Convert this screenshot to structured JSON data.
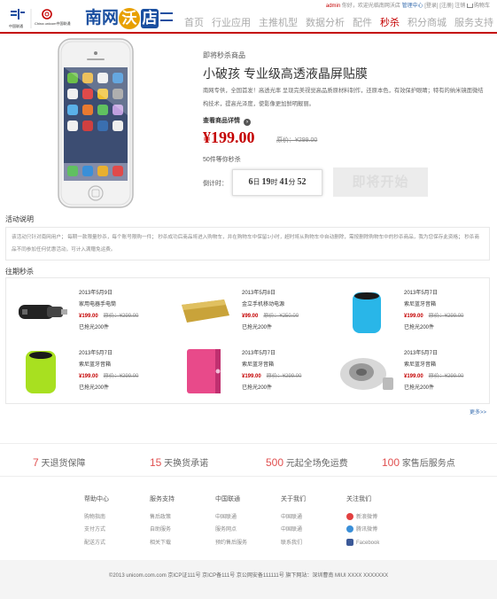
{
  "header": {
    "unicom_logo_text_cn": "中国联通",
    "unicom_logo_text_en": "China unicom中国联通",
    "brand_a": "南网",
    "brand_b": "沃",
    "brand_c": "店",
    "user": "admin",
    "greeting": "你好，欢迎光临南网沃店",
    "manage": "管理中心",
    "login": "[登录]",
    "register": "[注册]",
    "logout": "注销",
    "cart": "购物车",
    "nav": [
      "首页",
      "行业应用",
      "主推机型",
      "数据分析",
      "配件",
      "秒杀",
      "积分商城",
      "服务支持"
    ],
    "active_nav": "秒杀"
  },
  "product": {
    "crumb": "即将秒杀商品",
    "title": "小破孩 专业级高透液晶屏贴膜",
    "desc": "南网专供，全国首发！高透光率 呈现完美视觉高品质原材料制作，还原本色，有效保护眼睛；特有的纳米镜面微结构技术，提高光泽度，使影像更加鲜明靓丽。",
    "detail_link": "查看商品详情",
    "price": "¥199.00",
    "orig_price": "原价：¥299.00",
    "waiting": "50件等你秒杀",
    "countdown_label": "倒计时：",
    "cd_d": "6",
    "cd_d_u": "日",
    "cd_h": "19",
    "cd_h_u": "时",
    "cd_m": "41",
    "cd_m_u": "分",
    "cd_s": "52",
    "buy_btn": "即将开始"
  },
  "activity": {
    "title": "活动说明",
    "text": "该活动只针对南网用户； 每期一款限量秒杀，每个账号限购一件； 秒杀成功后商品将进入购物车，并在购物车中保留1小时，超时将从购物车中自动删除，需按删除购物车中的秒杀商品，我为您保存此资格； 秒杀商品不同参加任何优惠活动，可计入满赠免运费。"
  },
  "past": {
    "title": "往期秒杀",
    "more": "更多>>",
    "items": [
      {
        "date": "2013年5月9日",
        "name": "家用电器手电筒",
        "price": "¥199.00",
        "orig": "原价：¥299.00",
        "sold": "已抢光200件",
        "img": "car-charger-icon"
      },
      {
        "date": "2013年5月8日",
        "name": "金立手机移动电源",
        "price": "¥99.00",
        "orig": "原价：¥250.00",
        "sold": "已抢光200件",
        "img": "power-bank-icon"
      },
      {
        "date": "2013年5月7日",
        "name": "索尼蓝牙音箱",
        "price": "¥199.00",
        "orig": "原价：¥299.00",
        "sold": "已抢光200件",
        "img": "blue-speaker-icon"
      },
      {
        "date": "2013年5月7日",
        "name": "索尼蓝牙音箱",
        "price": "¥199.00",
        "orig": "原价：¥299.00",
        "sold": "已抢光200件",
        "img": "green-speaker-icon"
      },
      {
        "date": "2013年5月7日",
        "name": "索尼蓝牙音箱",
        "price": "¥199.00",
        "orig": "原价：¥299.00",
        "sold": "已抢光200件",
        "img": "pink-case-icon"
      },
      {
        "date": "2013年5月7日",
        "name": "索尼蓝牙音箱",
        "price": "¥199.00",
        "orig": "原价：¥299.00",
        "sold": "已抢光200件",
        "img": "grey-speaker-icon"
      }
    ]
  },
  "guarantees": [
    {
      "num": "7",
      "text": "天退货保障"
    },
    {
      "num": "15",
      "text": "天换货承诺"
    },
    {
      "num": "500",
      "text": "元起全场免运费"
    },
    {
      "num": "100",
      "text": "家售后服务点"
    }
  ],
  "footer": {
    "cols": [
      {
        "title": "帮助中心",
        "links": [
          "购物指南",
          "支付方式",
          "配送方式"
        ]
      },
      {
        "title": "服务支持",
        "links": [
          "售后政策",
          "自助服务",
          "相关下载"
        ]
      },
      {
        "title": "中国联通",
        "links": [
          "中国联通",
          "服务网点",
          "预约售后服务"
        ]
      },
      {
        "title": "关于我们",
        "links": [
          "中国联通",
          "中国联通",
          "联系我们"
        ]
      },
      {
        "title": "关注我们",
        "links": [
          "新浪微博",
          "腾讯微博",
          "Facebook"
        ]
      }
    ],
    "copyright": "©2013 unicom.com.com 京ICP证111号 京ICP备111号 京公网安备111111号     旗下网站：深圳曹南 MIUI XXXX XXXXXXX"
  },
  "colors": {
    "accent": "#c40000",
    "link": "#3a6fb0"
  }
}
